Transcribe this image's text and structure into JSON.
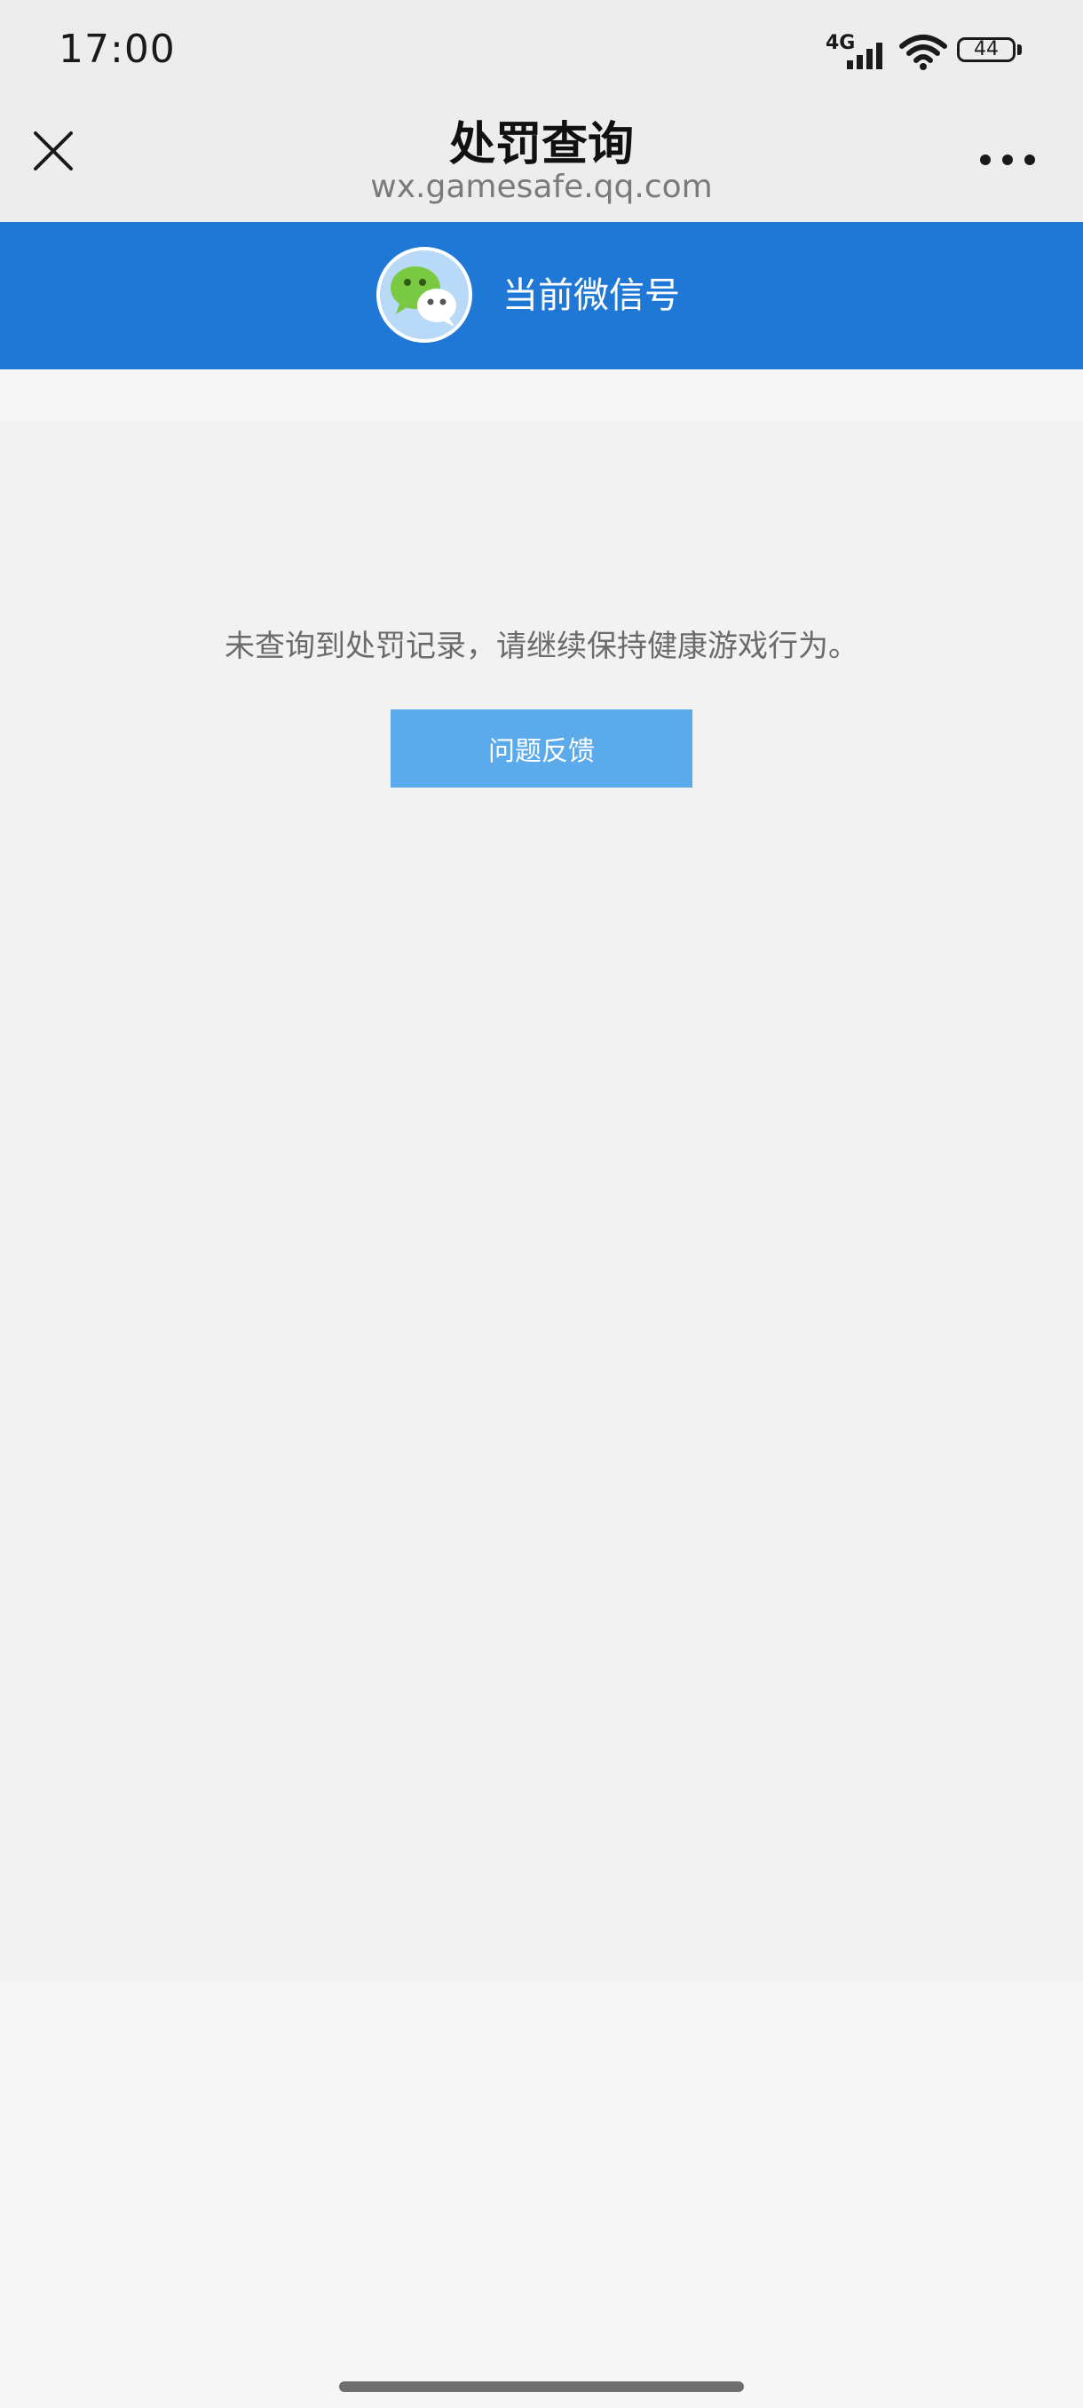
{
  "status_bar": {
    "time": "17:00",
    "network": "4G",
    "battery": "44"
  },
  "nav": {
    "title": "处罚查询",
    "url": "wx.gamesafe.qq.com"
  },
  "account": {
    "label": "当前微信号"
  },
  "result": {
    "message": "未查询到处罚记录，请继续保持健康游戏行为。",
    "feedback_label": "问题反馈"
  },
  "colors": {
    "header_blue": "#1f78d6",
    "button_blue": "#5aaaec",
    "nav_bg": "#ededed",
    "main_bg": "#f2f2f2"
  }
}
